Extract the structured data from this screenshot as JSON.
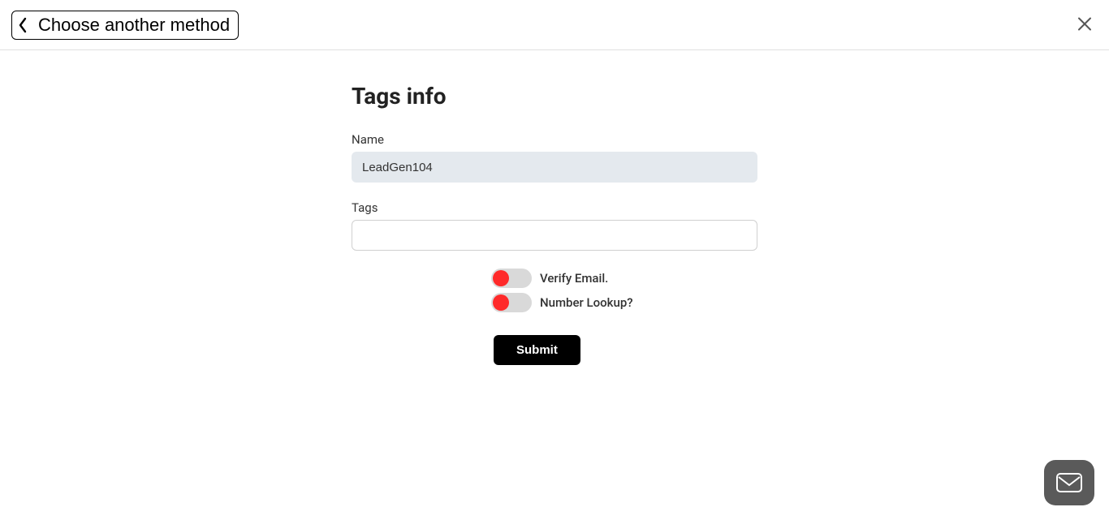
{
  "header": {
    "back_label": "Choose another method"
  },
  "form": {
    "title": "Tags info",
    "name_label": "Name",
    "name_value": "LeadGen104",
    "tags_label": "Tags",
    "tags_value": "",
    "verify_email_label": "Verify Email.",
    "verify_email_on": false,
    "number_lookup_label": "Number Lookup?",
    "number_lookup_on": false,
    "submit_label": "Submit"
  }
}
